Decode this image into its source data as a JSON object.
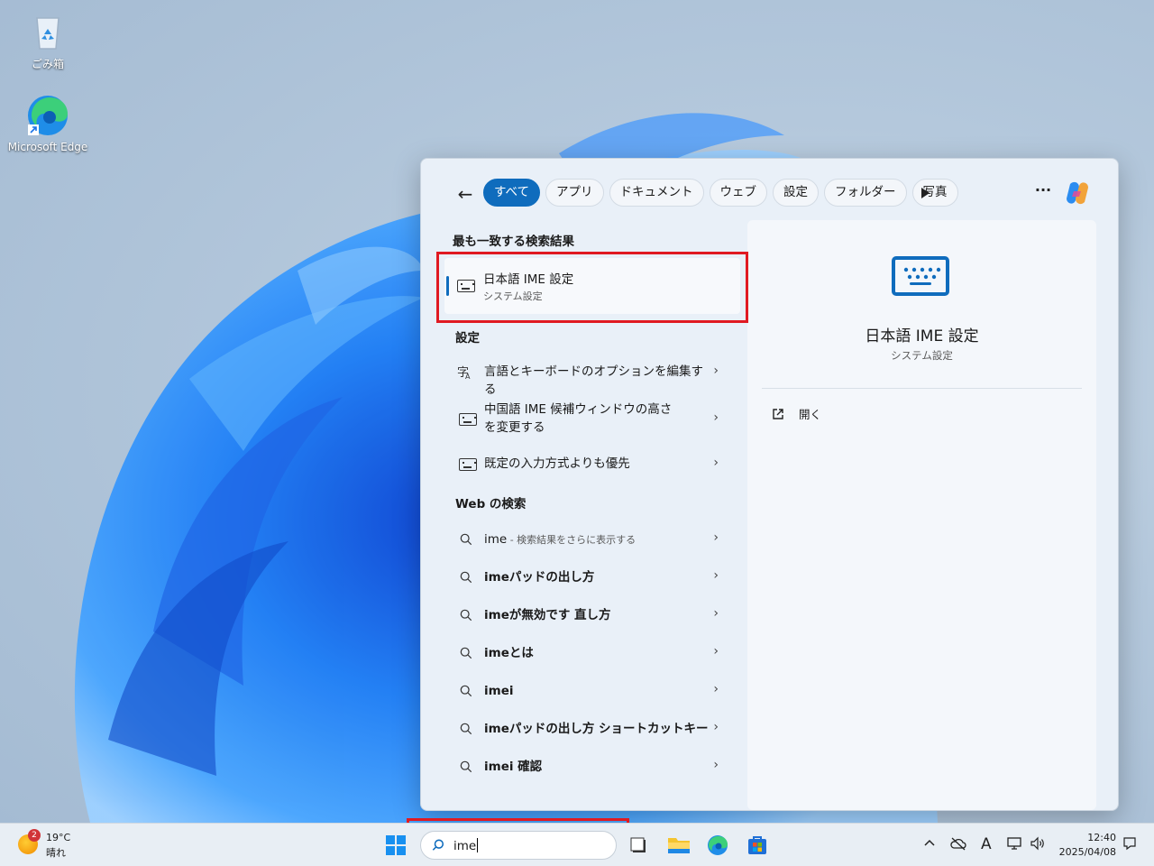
{
  "desktop": {
    "icons": [
      {
        "label": "ごみ箱",
        "icon": "recycle-bin-icon"
      },
      {
        "label": "Microsoft Edge",
        "icon": "edge-icon"
      }
    ]
  },
  "search_panel": {
    "filters": [
      "すべて",
      "アプリ",
      "ドキュメント",
      "ウェブ",
      "設定",
      "フォルダー",
      "写真"
    ],
    "active_filter": "すべて",
    "best_match_heading": "最も一致する検索結果",
    "best_match": {
      "title": "日本語 IME 設定",
      "subtitle": "システム設定",
      "icon": "keyboard-icon"
    },
    "settings_heading": "設定",
    "settings_items": [
      {
        "label": "言語とキーボードのオプションを編集する",
        "icon": "language-icon"
      },
      {
        "label": "中国語 IME 候補ウィンドウの高さを変更する",
        "icon": "keyboard-icon"
      },
      {
        "label": "既定の入力方式よりも優先",
        "icon": "keyboard-icon"
      }
    ],
    "web_heading": "Web の検索",
    "web_items": [
      {
        "label": "ime",
        "hint": " - 検索結果をさらに表示する"
      },
      {
        "label": "imeパッドの出し方",
        "hint": ""
      },
      {
        "label": "imeが無効です 直し方",
        "hint": ""
      },
      {
        "label": "imeとは",
        "hint": ""
      },
      {
        "label": "imei",
        "hint": ""
      },
      {
        "label": "imeパッドの出し方 ショートカットキー",
        "hint": ""
      },
      {
        "label": "imei 確認",
        "hint": ""
      }
    ],
    "preview": {
      "title": "日本語 IME 設定",
      "subtitle": "システム設定",
      "action": "開く"
    }
  },
  "taskbar": {
    "weather": {
      "temp": "19°C",
      "condition": "晴れ",
      "badge": "2"
    },
    "search_value": "ime",
    "clock": {
      "time": "12:40",
      "date": "2025/04/08"
    },
    "ime_indicator": "A"
  },
  "colors": {
    "accent": "#0f6cbd",
    "highlight": "#e01a22"
  }
}
